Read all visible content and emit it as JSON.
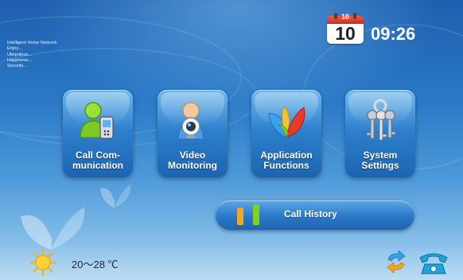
{
  "tagline": {
    "title": "Intelligent Home Network",
    "lines": [
      "Enjoy...",
      "Ubiquitous...",
      "Happiness...",
      "Security..."
    ]
  },
  "clock": {
    "calendar_month": "10",
    "calendar_day": "10",
    "time": "09:26"
  },
  "tiles": [
    {
      "label": "Call Com-\nmunication",
      "icon": "contacts-phone-icon"
    },
    {
      "label": "Video\nMonitoring",
      "icon": "webcam-icon"
    },
    {
      "label": "Application\nFunctions",
      "icon": "butterfly-app-icon"
    },
    {
      "label": "System\nSettings",
      "icon": "keys-icon"
    }
  ],
  "history": {
    "label": "Call History",
    "bar_colors": [
      "#f5a623",
      "#7ed321"
    ]
  },
  "status": {
    "weather_icon": "sun-icon",
    "temperature": "20～28 ℃",
    "sync_icon": "sync-arrows-icon",
    "phone_icon": "telephone-icon"
  },
  "colors": {
    "background": "#2a78c6",
    "tile": "#2c7fcc",
    "accent_red": "#e03a2c"
  }
}
